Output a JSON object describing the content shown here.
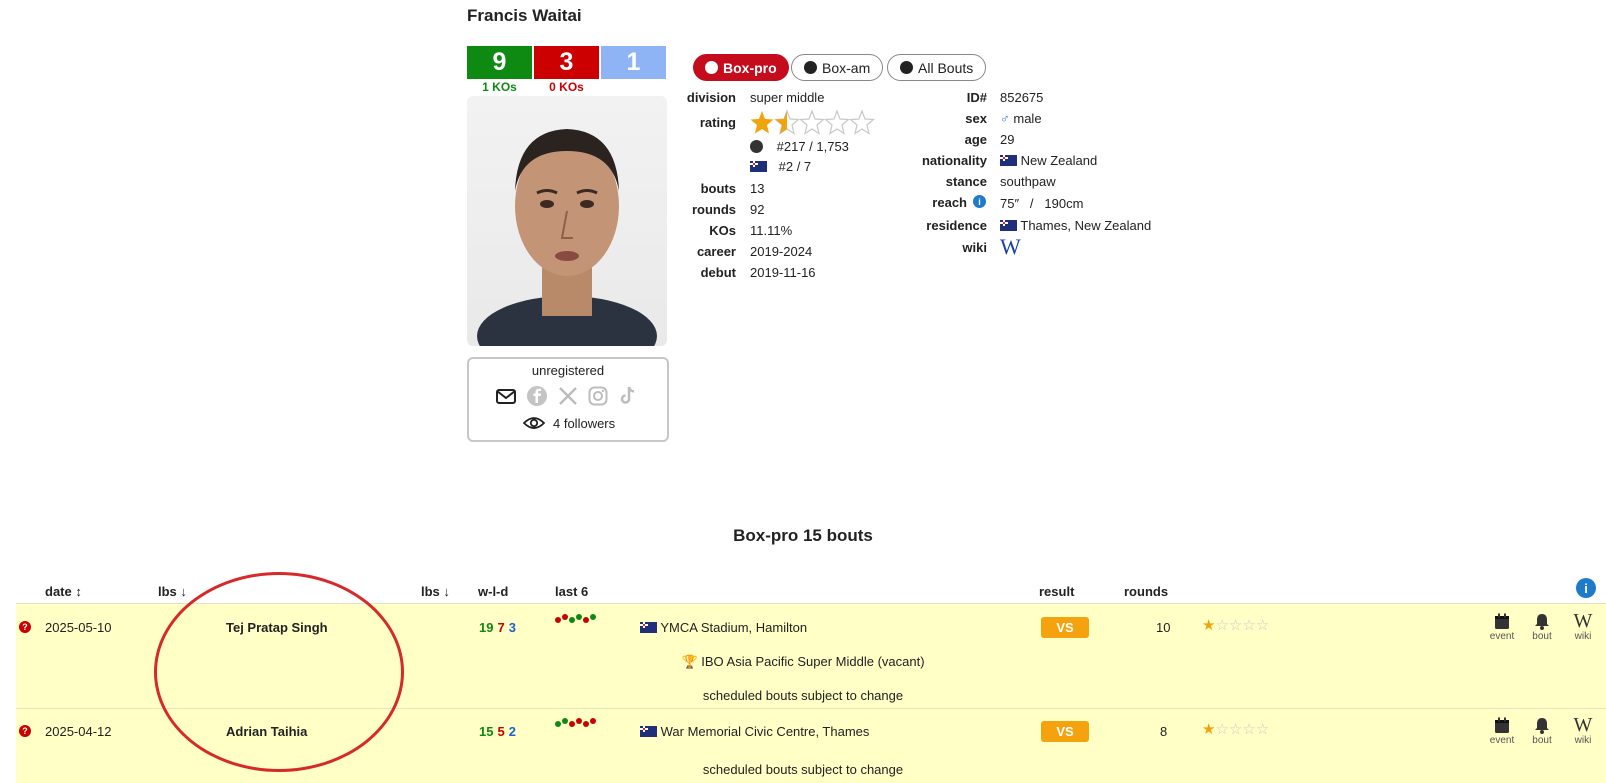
{
  "boxer": {
    "name": "Francis Waitai",
    "record": {
      "wins": "9",
      "losses": "3",
      "draws": "1",
      "wins_ko": "1 KOs",
      "losses_ko": "0 KOs"
    },
    "social_status": "unregistered",
    "followers": "4 followers",
    "social_icons": [
      "mail-icon",
      "facebook-icon",
      "x-icon",
      "instagram-icon",
      "tiktok-icon"
    ]
  },
  "tabs": [
    {
      "label": "Box-pro",
      "active": true
    },
    {
      "label": "Box-am",
      "active": false
    },
    {
      "label": "All Bouts",
      "active": false
    }
  ],
  "details_left": {
    "division_label": "division",
    "division": "super middle",
    "rating_label": "rating",
    "rating_stars": 1.5,
    "rating_max": 5,
    "world_rank": "#217 / 1,753",
    "country_rank": "#2 / 7",
    "bouts_label": "bouts",
    "bouts": "13",
    "rounds_label": "rounds",
    "rounds": "92",
    "kos_label": "KOs",
    "kos": "11.11%",
    "career_label": "career",
    "career": "2019-2024",
    "debut_label": "debut",
    "debut": "2019-11-16"
  },
  "details_right": {
    "id_label": "ID#",
    "id": "852675",
    "sex_label": "sex",
    "sex": "male",
    "age_label": "age",
    "age": "29",
    "nationality_label": "nationality",
    "nationality": "New Zealand",
    "stance_label": "stance",
    "stance": "southpaw",
    "reach_label": "reach",
    "reach_in": "75″",
    "reach_sep": "/",
    "reach_cm": "190cm",
    "residence_label": "residence",
    "residence": "Thames, New Zealand",
    "wiki_label": "wiki",
    "wiki_glyph": "W"
  },
  "bouts_section": {
    "title": "Box-pro 15 bouts",
    "headers": {
      "date": "date",
      "lbs1": "lbs",
      "lbs2": "lbs",
      "wld": "w-l-d",
      "last6": "last 6",
      "result": "result",
      "rounds": "rounds"
    },
    "rows": [
      {
        "date": "2025-05-10",
        "opponent": "Tej Pratap Singh",
        "w": "19",
        "l": "7",
        "d": "3",
        "last6": [
          "r",
          "r",
          "g",
          "g",
          "r",
          "g"
        ],
        "venue": "YMCA Stadium, Hamilton",
        "result": "VS",
        "rounds": "10",
        "stars": 1,
        "title_fight": "IBO Asia Pacific Super Middle (vacant)",
        "note": "scheduled bouts subject to change"
      },
      {
        "date": "2025-04-12",
        "opponent": "Adrian Taihia",
        "w": "15",
        "l": "5",
        "d": "2",
        "last6": [
          "g",
          "g",
          "r",
          "r",
          "r",
          "r"
        ],
        "venue": "War Memorial Civic Centre, Thames",
        "result": "VS",
        "rounds": "8",
        "stars": 1,
        "note": "scheduled bouts subject to change"
      }
    ],
    "actions": {
      "event": "event",
      "bout": "bout",
      "wiki": "wiki"
    }
  },
  "colors": {
    "win": "#0e8a12",
    "loss": "#cc0000",
    "draw": "#8fb4f5",
    "accent": "#c40c1c",
    "row_bg": "#ffffc6",
    "vs": "#f5a20f",
    "star": "#f0a30a"
  }
}
